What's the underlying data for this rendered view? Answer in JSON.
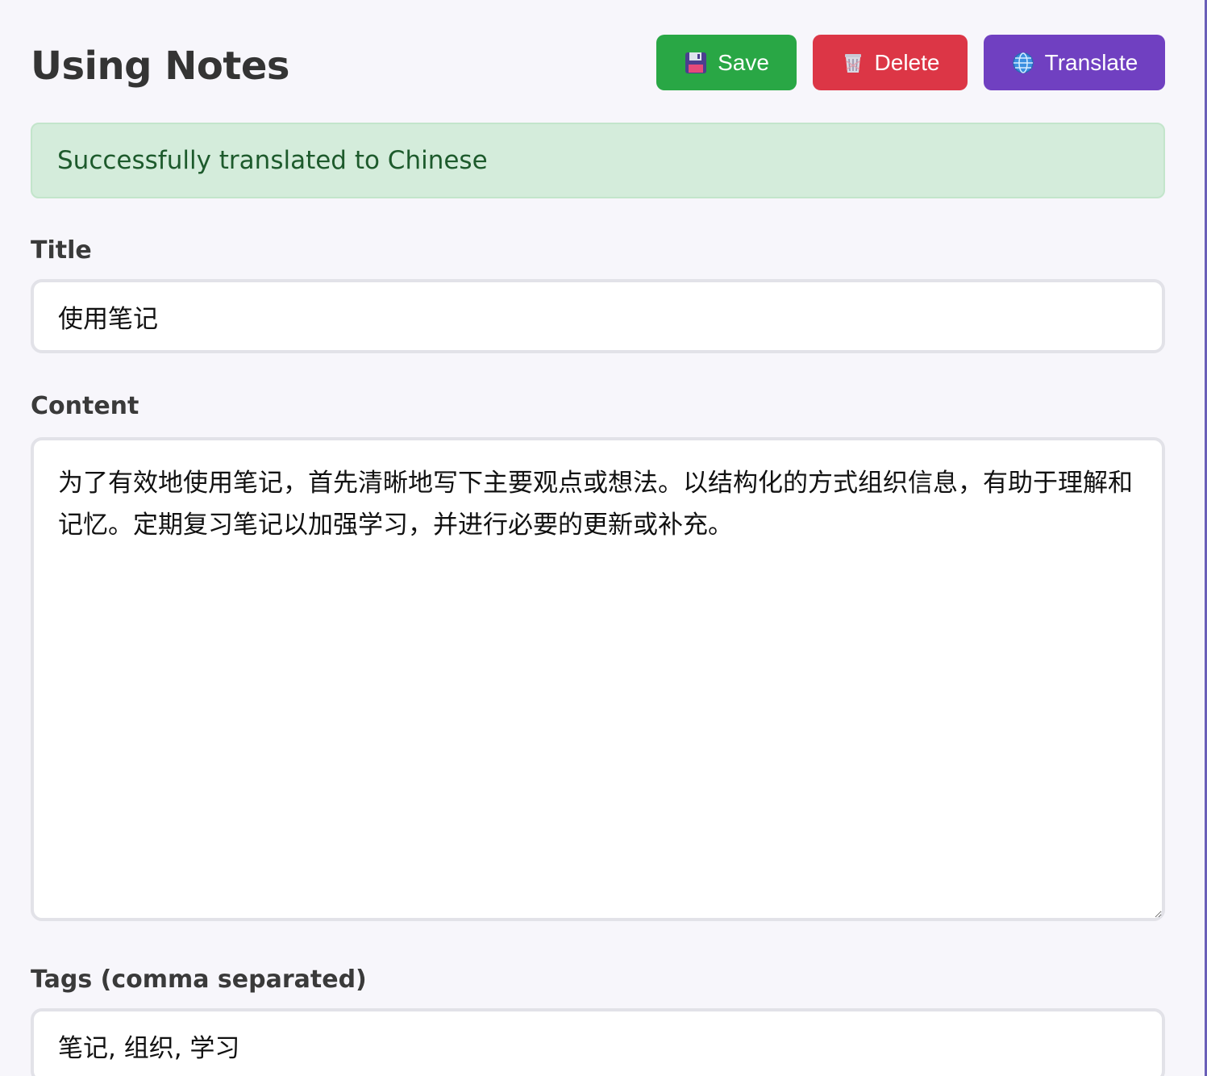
{
  "header": {
    "title": "Using Notes",
    "buttons": {
      "save_label": "Save",
      "save_icon": "floppy-disk-icon",
      "delete_label": "Delete",
      "delete_icon": "wastebasket-icon",
      "translate_label": "Translate",
      "translate_icon": "globe-icon"
    }
  },
  "alert": {
    "message": "Successfully translated to Chinese"
  },
  "form": {
    "title_label": "Title",
    "title_value": "使用笔记",
    "content_label": "Content",
    "content_value": "为了有效地使用笔记，首先清晰地写下主要观点或想法。以结构化的方式组织信息，有助于理解和记忆。定期复习笔记以加强学习，并进行必要的更新或补充。",
    "tags_label": "Tags (comma separated)",
    "tags_value": "笔记, 组织, 学习"
  },
  "colors": {
    "save": "#29a745",
    "delete": "#dc3646",
    "translate": "#7040c1",
    "alert_bg": "#d4ecdb",
    "alert_text": "#1d5a2c",
    "page_bg": "#f7f6fb"
  }
}
